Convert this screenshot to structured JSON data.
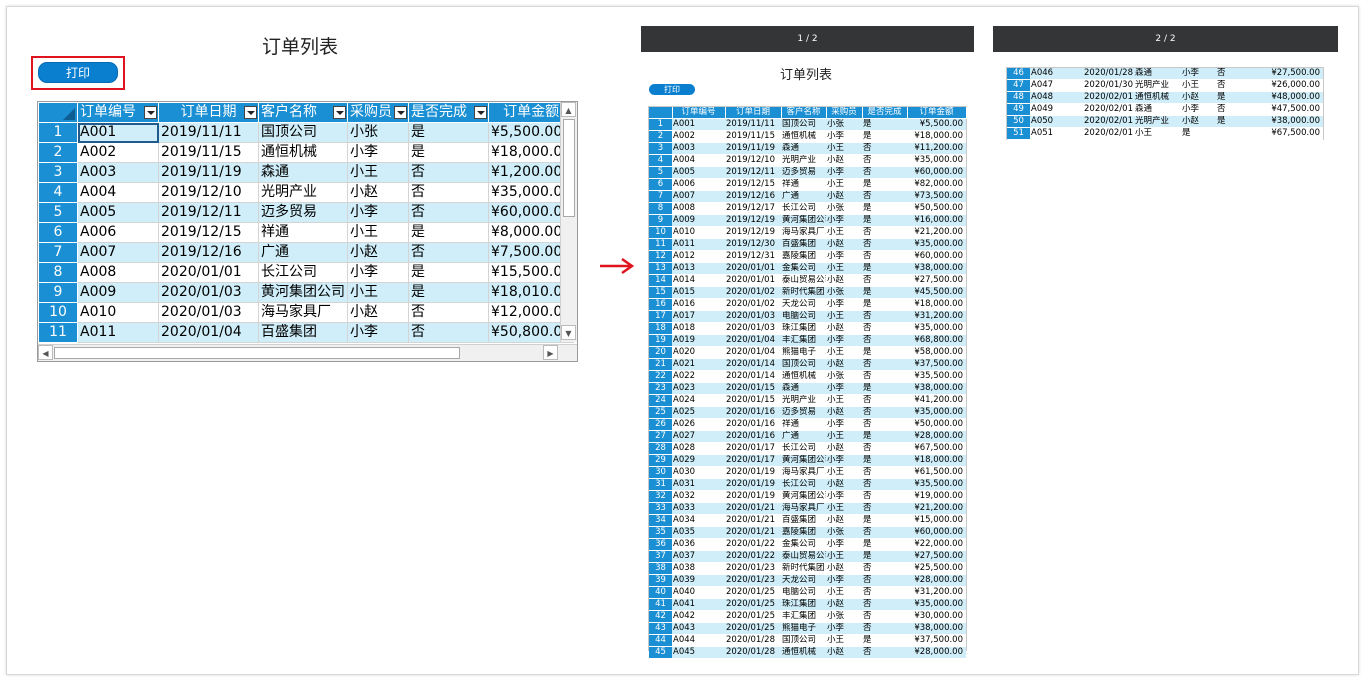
{
  "sheet": {
    "title": "订单列表",
    "print_label": "打印",
    "columns": [
      "订单编号",
      "订单日期",
      "客户名称",
      "采购员",
      "是否完成",
      "订单金额"
    ],
    "rows": [
      [
        "1",
        "A001",
        "2019/11/11",
        "国顶公司",
        "小张",
        "是",
        "¥5,500.00"
      ],
      [
        "2",
        "A002",
        "2019/11/15",
        "通恒机械",
        "小李",
        "是",
        "¥18,000.00"
      ],
      [
        "3",
        "A003",
        "2019/11/19",
        "森通",
        "小王",
        "否",
        "¥1,200.00"
      ],
      [
        "4",
        "A004",
        "2019/12/10",
        "光明产业",
        "小赵",
        "否",
        "¥35,000.00"
      ],
      [
        "5",
        "A005",
        "2019/12/11",
        "迈多贸易",
        "小李",
        "否",
        "¥60,000.00"
      ],
      [
        "6",
        "A006",
        "2019/12/15",
        "祥通",
        "小王",
        "是",
        "¥8,000.00"
      ],
      [
        "7",
        "A007",
        "2019/12/16",
        "广通",
        "小赵",
        "否",
        "¥7,500.00"
      ],
      [
        "8",
        "A008",
        "2020/01/01",
        "长江公司",
        "小李",
        "是",
        "¥15,500.00"
      ],
      [
        "9",
        "A009",
        "2020/01/03",
        "黄河集团公司",
        "小王",
        "是",
        "¥18,010.00"
      ],
      [
        "10",
        "A010",
        "2020/01/03",
        "海马家具厂",
        "小赵",
        "否",
        "¥12,000.00"
      ],
      [
        "11",
        "A011",
        "2020/01/04",
        "百盛集团",
        "小李",
        "否",
        "¥50,800.00"
      ]
    ]
  },
  "preview": {
    "page1_label": "1 / 2",
    "page2_label": "2 / 2",
    "title": "订单列表",
    "print_label": "打印",
    "columns": [
      "订单编号",
      "订单日期",
      "客户名称",
      "采购员",
      "是否完成",
      "订单金额"
    ],
    "page1_rows": [
      [
        "1",
        "A001",
        "2019/11/11",
        "国顶公司",
        "小张",
        "是",
        "¥5,500.00"
      ],
      [
        "2",
        "A002",
        "2019/11/15",
        "通恒机械",
        "小李",
        "是",
        "¥18,000.00"
      ],
      [
        "3",
        "A003",
        "2019/11/19",
        "森通",
        "小王",
        "否",
        "¥11,200.00"
      ],
      [
        "4",
        "A004",
        "2019/12/10",
        "光明产业",
        "小赵",
        "否",
        "¥35,000.00"
      ],
      [
        "5",
        "A005",
        "2019/12/11",
        "迈多贸易",
        "小李",
        "否",
        "¥60,000.00"
      ],
      [
        "6",
        "A006",
        "2019/12/15",
        "祥通",
        "小王",
        "是",
        "¥82,000.00"
      ],
      [
        "7",
        "A007",
        "2019/12/16",
        "广通",
        "小赵",
        "否",
        "¥73,500.00"
      ],
      [
        "8",
        "A008",
        "2019/12/17",
        "长江公司",
        "小张",
        "是",
        "¥50,500.00"
      ],
      [
        "9",
        "A009",
        "2019/12/19",
        "黄河集团公司",
        "小李",
        "是",
        "¥16,000.00"
      ],
      [
        "10",
        "A010",
        "2019/12/19",
        "海马家具厂",
        "小王",
        "否",
        "¥21,200.00"
      ],
      [
        "11",
        "A011",
        "2019/12/30",
        "百盛集团",
        "小赵",
        "否",
        "¥35,000.00"
      ],
      [
        "12",
        "A012",
        "2019/12/31",
        "嘉陵集团",
        "小李",
        "否",
        "¥60,000.00"
      ],
      [
        "13",
        "A013",
        "2020/01/01",
        "金集公司",
        "小王",
        "是",
        "¥38,000.00"
      ],
      [
        "14",
        "A014",
        "2020/01/01",
        "泰山贸易公司",
        "小赵",
        "否",
        "¥27,500.00"
      ],
      [
        "15",
        "A015",
        "2020/01/02",
        "新时代集团",
        "小张",
        "是",
        "¥45,500.00"
      ],
      [
        "16",
        "A016",
        "2020/01/02",
        "天龙公司",
        "小李",
        "是",
        "¥18,000.00"
      ],
      [
        "17",
        "A017",
        "2020/01/03",
        "电脑公司",
        "小王",
        "否",
        "¥31,200.00"
      ],
      [
        "18",
        "A018",
        "2020/01/03",
        "珠江集团",
        "小赵",
        "否",
        "¥35,000.00"
      ],
      [
        "19",
        "A019",
        "2020/01/04",
        "丰汇集团",
        "小李",
        "否",
        "¥68,800.00"
      ],
      [
        "20",
        "A020",
        "2020/01/04",
        "熊猫电子",
        "小王",
        "是",
        "¥58,000.00"
      ],
      [
        "21",
        "A021",
        "2020/01/14",
        "国顶公司",
        "小赵",
        "否",
        "¥37,500.00"
      ],
      [
        "22",
        "A022",
        "2020/01/14",
        "通恒机械",
        "小张",
        "否",
        "¥35,500.00"
      ],
      [
        "23",
        "A023",
        "2020/01/15",
        "森通",
        "小李",
        "是",
        "¥38,000.00"
      ],
      [
        "24",
        "A024",
        "2020/01/15",
        "光明产业",
        "小王",
        "否",
        "¥41,200.00"
      ],
      [
        "25",
        "A025",
        "2020/01/16",
        "迈多贸易",
        "小赵",
        "否",
        "¥35,000.00"
      ],
      [
        "26",
        "A026",
        "2020/01/16",
        "祥通",
        "小李",
        "否",
        "¥50,000.00"
      ],
      [
        "27",
        "A027",
        "2020/01/16",
        "广通",
        "小王",
        "是",
        "¥28,000.00"
      ],
      [
        "28",
        "A028",
        "2020/01/17",
        "长江公司",
        "小赵",
        "否",
        "¥67,500.00"
      ],
      [
        "29",
        "A029",
        "2020/01/17",
        "黄河集团公司",
        "小李",
        "是",
        "¥18,000.00"
      ],
      [
        "30",
        "A030",
        "2020/01/19",
        "海马家具厂",
        "小王",
        "否",
        "¥61,500.00"
      ],
      [
        "31",
        "A031",
        "2020/01/19",
        "长江公司",
        "小赵",
        "否",
        "¥35,500.00"
      ],
      [
        "32",
        "A032",
        "2020/01/19",
        "黄河集团公司",
        "小李",
        "否",
        "¥19,000.00"
      ],
      [
        "33",
        "A033",
        "2020/01/21",
        "海马家具厂",
        "小王",
        "否",
        "¥21,200.00"
      ],
      [
        "34",
        "A034",
        "2020/01/21",
        "百盛集团",
        "小赵",
        "是",
        "¥15,000.00"
      ],
      [
        "35",
        "A035",
        "2020/01/21",
        "嘉陵集团",
        "小张",
        "否",
        "¥60,000.00"
      ],
      [
        "36",
        "A036",
        "2020/01/22",
        "金集公司",
        "小李",
        "是",
        "¥22,000.00"
      ],
      [
        "37",
        "A037",
        "2020/01/22",
        "泰山贸易公司",
        "小王",
        "是",
        "¥27,500.00"
      ],
      [
        "38",
        "A038",
        "2020/01/23",
        "新时代集团",
        "小赵",
        "否",
        "¥25,500.00"
      ],
      [
        "39",
        "A039",
        "2020/01/23",
        "天龙公司",
        "小李",
        "否",
        "¥28,000.00"
      ],
      [
        "40",
        "A040",
        "2020/01/25",
        "电脑公司",
        "小王",
        "否",
        "¥31,200.00"
      ],
      [
        "41",
        "A041",
        "2020/01/25",
        "珠江集团",
        "小赵",
        "否",
        "¥35,000.00"
      ],
      [
        "42",
        "A042",
        "2020/01/25",
        "丰汇集团",
        "小张",
        "否",
        "¥30,000.00"
      ],
      [
        "43",
        "A043",
        "2020/01/25",
        "熊猫电子",
        "小李",
        "否",
        "¥38,000.00"
      ],
      [
        "44",
        "A044",
        "2020/01/28",
        "国顶公司",
        "小王",
        "是",
        "¥37,500.00"
      ],
      [
        "45",
        "A045",
        "2020/01/28",
        "通恒机械",
        "小赵",
        "否",
        "¥28,000.00"
      ]
    ],
    "page2_rows": [
      [
        "46",
        "A046",
        "2020/01/28",
        "森通",
        "小李",
        "否",
        "¥27,500.00"
      ],
      [
        "47",
        "A047",
        "2020/01/30",
        "光明产业",
        "小王",
        "否",
        "¥26,000.00"
      ],
      [
        "48",
        "A048",
        "2020/02/01",
        "通恒机械",
        "小赵",
        "是",
        "¥48,000.00"
      ],
      [
        "49",
        "A049",
        "2020/02/01",
        "森通",
        "小李",
        "否",
        "¥47,500.00"
      ],
      [
        "50",
        "A050",
        "2020/02/01",
        "光明产业",
        "小赵",
        "是",
        "¥38,000.00"
      ],
      [
        "51",
        "A051",
        "2020/02/01",
        "小王",
        "是",
        "",
        "¥67,500.00"
      ]
    ]
  }
}
